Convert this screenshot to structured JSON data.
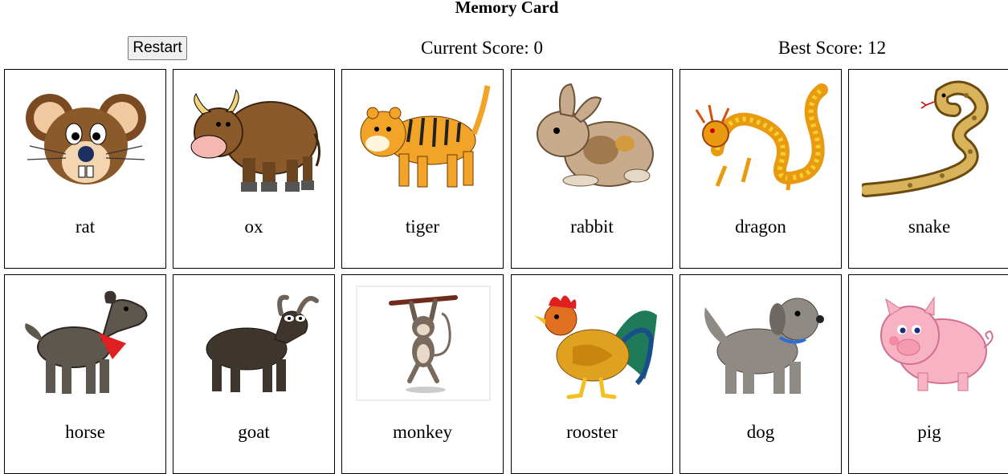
{
  "title": "Memory Card",
  "controls": {
    "restart_label": "Restart",
    "current_score": "Current Score: 0",
    "best_score": "Best Score: 12"
  },
  "cards": [
    {
      "label": "rat",
      "icon": "rat-icon"
    },
    {
      "label": "ox",
      "icon": "ox-icon"
    },
    {
      "label": "tiger",
      "icon": "tiger-icon"
    },
    {
      "label": "rabbit",
      "icon": "rabbit-icon"
    },
    {
      "label": "dragon",
      "icon": "dragon-icon"
    },
    {
      "label": "snake",
      "icon": "snake-icon"
    },
    {
      "label": "horse",
      "icon": "horse-icon"
    },
    {
      "label": "goat",
      "icon": "goat-icon"
    },
    {
      "label": "monkey",
      "icon": "monkey-icon"
    },
    {
      "label": "rooster",
      "icon": "rooster-icon"
    },
    {
      "label": "dog",
      "icon": "dog-icon"
    },
    {
      "label": "pig",
      "icon": "pig-icon"
    }
  ]
}
